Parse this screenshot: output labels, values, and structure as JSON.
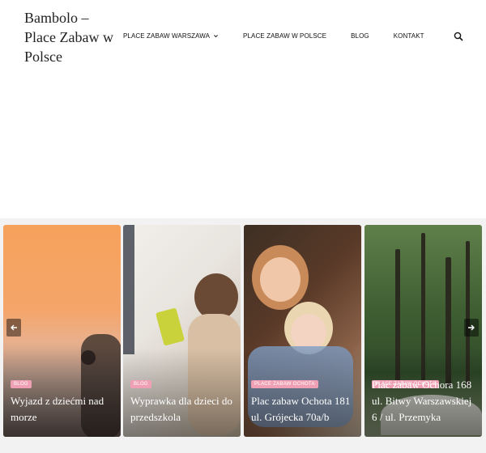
{
  "site": {
    "title": "Bambolo – Place Zabaw w Polsce"
  },
  "nav": {
    "items": [
      {
        "label": "PLACE ZABAW WARSZAWA",
        "has_dropdown": true
      },
      {
        "label": "PLACE ZABAW W POLSCE",
        "has_dropdown": false
      },
      {
        "label": "BLOG",
        "has_dropdown": false
      },
      {
        "label": "KONTAKT",
        "has_dropdown": false
      }
    ],
    "search_icon": "search-icon"
  },
  "slider": {
    "prev_icon": "arrow-left-icon",
    "next_icon": "arrow-right-icon",
    "cards": [
      {
        "badge": "BLOG",
        "title": "Wyjazd z dziećmi nad morze"
      },
      {
        "badge": "BLOG",
        "title": "Wyprawka dla dzieci do przedszkola"
      },
      {
        "badge": "PLACE ZABAW OCHOTA",
        "title": "Plac zabaw Ochota 181 ul. Grójecka 70a/b"
      },
      {
        "badge": "PLACE ZABAW OCHOTA",
        "title": "Plac zabaw Ochora 168 ul. Bitwy Warszawskiej 6 / ul. Przemyka"
      }
    ]
  },
  "colors": {
    "badge": "#f0a0b5",
    "band": "#f2f2f2"
  }
}
